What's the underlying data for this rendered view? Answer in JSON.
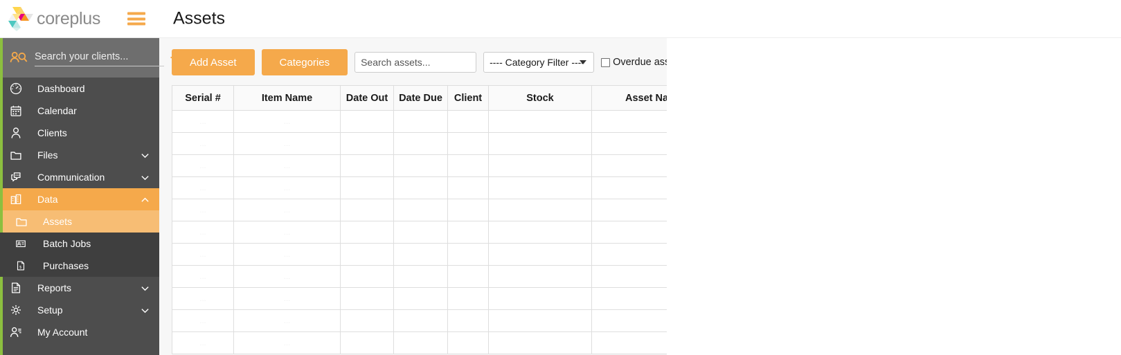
{
  "brand": {
    "name": "coreplus",
    "logo_icon": "coreplus-triangles-logo",
    "menu_icon": "hamburger-menu-icon"
  },
  "client_search": {
    "placeholder": "Search your clients...",
    "value": "",
    "icon": "clients-search-icon",
    "add_icon": "plus-icon"
  },
  "sidebar": {
    "items": [
      {
        "label": "Dashboard",
        "icon": "dashboard-gauge-icon",
        "state": "normal",
        "chevron": "none"
      },
      {
        "label": "Calendar",
        "icon": "calendar-icon",
        "state": "normal",
        "chevron": "none"
      },
      {
        "label": "Clients",
        "icon": "person-icon",
        "state": "normal",
        "chevron": "none"
      },
      {
        "label": "Files",
        "icon": "folder-icon",
        "state": "normal",
        "chevron": "down"
      },
      {
        "label": "Communication",
        "icon": "chat-bubble-icon",
        "state": "normal",
        "chevron": "down"
      },
      {
        "label": "Data",
        "icon": "database-building-icon",
        "state": "active",
        "chevron": "up"
      },
      {
        "label": "Assets",
        "icon": "folder-icon",
        "state": "sub-active",
        "chevron": "none"
      },
      {
        "label": "Batch Jobs",
        "icon": "batch-card-icon",
        "state": "sub",
        "chevron": "none"
      },
      {
        "label": "Purchases",
        "icon": "invoice-dollar-icon",
        "state": "sub",
        "chevron": "none"
      },
      {
        "label": "Reports",
        "icon": "document-lines-icon",
        "state": "normal",
        "chevron": "down"
      },
      {
        "label": "Setup",
        "icon": "gear-icon",
        "state": "normal",
        "chevron": "down"
      },
      {
        "label": "My Account",
        "icon": "user-account-icon",
        "state": "normal",
        "chevron": "none"
      }
    ]
  },
  "header": {
    "title": "Assets"
  },
  "toolbar": {
    "add_asset_label": "Add Asset",
    "categories_label": "Categories",
    "search_placeholder": "Search assets...",
    "search_value": "",
    "category_filter_selected": "---- Category Filter ----",
    "category_filter_options": [
      "---- Category Filter ----"
    ],
    "overdue_label": "Overdue assets",
    "overdue_checked": false
  },
  "table": {
    "columns": [
      "Serial #",
      "Item Name",
      "Date Out",
      "Date Due",
      "Client",
      "Stock",
      "Asset Name"
    ],
    "rows": [
      [
        "...",
        "...",
        "",
        "",
        "",
        "",
        ""
      ],
      [
        "...",
        "...",
        "",
        "",
        "",
        "",
        ""
      ],
      [
        "...",
        "...",
        "",
        "",
        "",
        "",
        ""
      ],
      [
        "...",
        "...",
        "",
        "",
        "",
        "",
        ""
      ],
      [
        "...",
        "...",
        "",
        "",
        "",
        "",
        ""
      ],
      [
        "...",
        "...",
        "",
        "",
        "",
        "",
        ""
      ],
      [
        "...",
        "...",
        "",
        "",
        "",
        "",
        ""
      ],
      [
        "...",
        "...",
        "",
        "",
        "",
        "",
        ""
      ],
      [
        "...",
        "...",
        "",
        "",
        "",
        "",
        ""
      ],
      [
        "...",
        "...",
        "",
        "",
        "",
        "",
        ""
      ],
      [
        "...",
        "...",
        "",
        "",
        "",
        "",
        ""
      ]
    ]
  },
  "colors": {
    "accent_orange": "#f5a94b",
    "accent_green": "#8cbf3f",
    "sidebar_bg": "#4d4d4d",
    "sidebar_search_bg": "#6e6e6e",
    "sub_item_bg": "#f7bd74",
    "content_bg": "#f7f7f7"
  }
}
